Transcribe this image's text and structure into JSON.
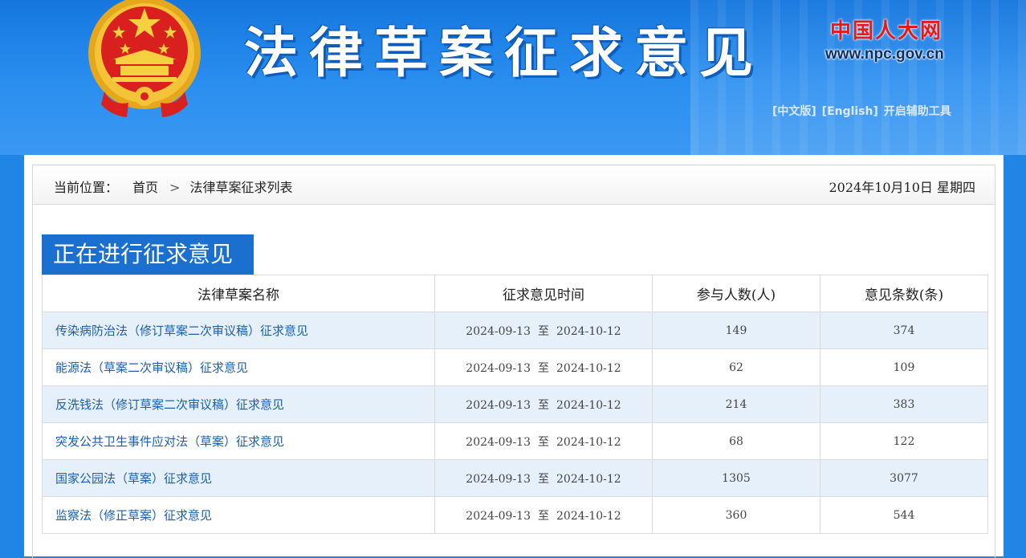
{
  "header": {
    "site_title": "法律草案征求意见",
    "npc_logo": "中国人大网",
    "npc_url": "www.npc.gov.cn",
    "links": [
      "[中文版]",
      "[English]",
      "开启辅助工具"
    ]
  },
  "breadcrumb": {
    "label": "当前位置：",
    "home": "首页",
    "separator": ">",
    "current": "法律草案征求列表"
  },
  "date_text": "2024年10月10日  星期四",
  "section_title": "正在进行征求意见",
  "table": {
    "headers": [
      "法律草案名称",
      "征求意见时间",
      "参与人数(人)",
      "意见条数(条)"
    ],
    "period_separator": "至",
    "rows": [
      {
        "name": "传染病防治法（修订草案二次审议稿）征求意见",
        "start": "2024-09-13",
        "end": "2024-10-12",
        "participants": "149",
        "comments": "374"
      },
      {
        "name": "能源法（草案二次审议稿）征求意见",
        "start": "2024-09-13",
        "end": "2024-10-12",
        "participants": "62",
        "comments": "109"
      },
      {
        "name": "反洗钱法（修订草案二次审议稿）征求意见",
        "start": "2024-09-13",
        "end": "2024-10-12",
        "participants": "214",
        "comments": "383"
      },
      {
        "name": "突发公共卫生事件应对法（草案）征求意见",
        "start": "2024-09-13",
        "end": "2024-10-12",
        "participants": "68",
        "comments": "122"
      },
      {
        "name": "国家公园法（草案）征求意见",
        "start": "2024-09-13",
        "end": "2024-10-12",
        "participants": "1305",
        "comments": "3077"
      },
      {
        "name": "监察法（修正草案）征求意见",
        "start": "2024-09-13",
        "end": "2024-10-12",
        "participants": "360",
        "comments": "544"
      }
    ]
  },
  "colors": {
    "header_blue": "#1f86e6",
    "section_blue": "#1a6fcf",
    "row_alt": "#e6f0fb",
    "link": "#1a5fb0"
  },
  "icons": [
    "national-emblem-icon"
  ]
}
